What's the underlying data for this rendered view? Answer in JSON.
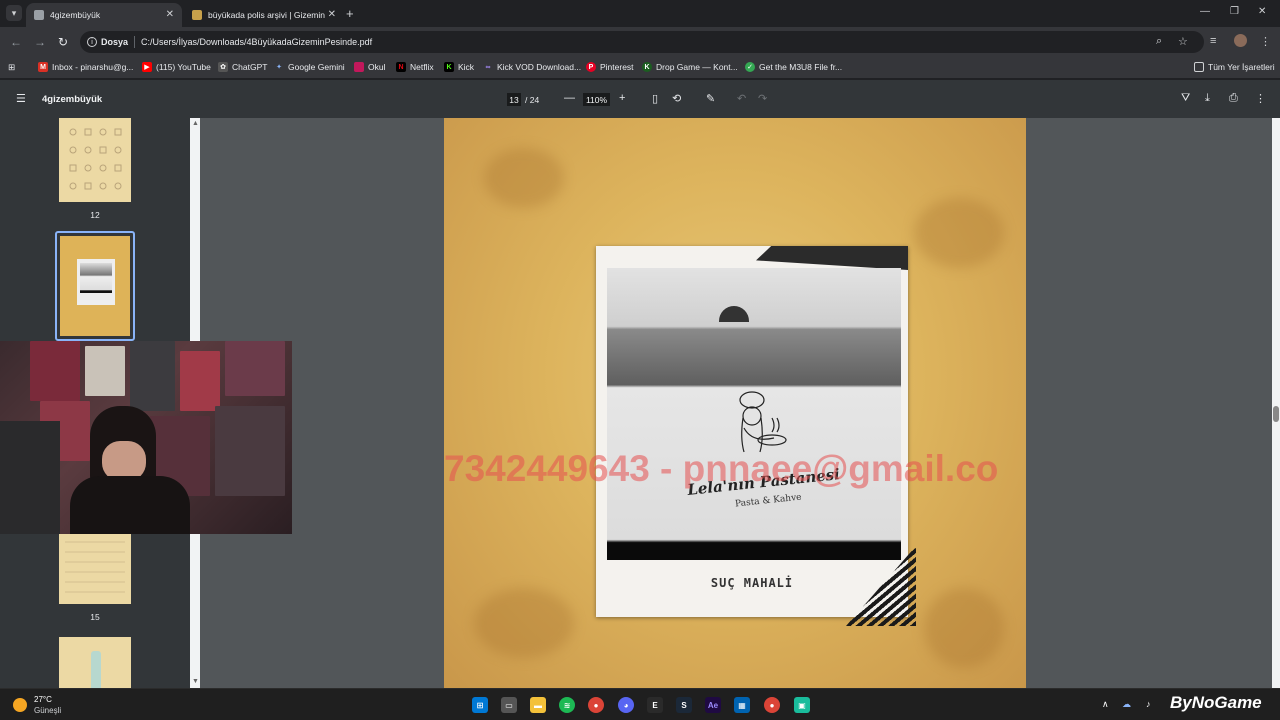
{
  "tabs": [
    {
      "label": "4gizembüyük",
      "active": true
    },
    {
      "label": "büyükada polis arşivi | Gizemin",
      "active": false
    }
  ],
  "address": {
    "chip": "Dosya",
    "url": "C:/Users/İlyas/Downloads/4BüyükadaGizeminPesinde.pdf"
  },
  "bookmarks": [
    {
      "label": "Inbox - pinarshu@g...",
      "icon": "gmail-icon",
      "color": "#d93025"
    },
    {
      "label": "(115) YouTube",
      "icon": "youtube-icon",
      "color": "#ff0000"
    },
    {
      "label": "ChatGPT",
      "icon": "chatgpt-icon",
      "color": "#555555"
    },
    {
      "label": "Google Gemini",
      "icon": "gemini-icon",
      "color": "#4285f4"
    },
    {
      "label": "Okul",
      "icon": "okul-icon",
      "color": "#c2185b"
    },
    {
      "label": "Netflix",
      "icon": "netflix-icon",
      "color": "#e50914"
    },
    {
      "label": "Kick",
      "icon": "kick-icon",
      "color": "#53fc18"
    },
    {
      "label": "Kick VOD Download...",
      "icon": "kickvod-icon",
      "color": "#7b61ff"
    },
    {
      "label": "Pinterest",
      "icon": "pinterest-icon",
      "color": "#e60023"
    },
    {
      "label": "Drop Game — Kont...",
      "icon": "dropgame-icon",
      "color": "#2e7d32"
    },
    {
      "label": "Get the M3U8 File fr...",
      "icon": "m3u8-icon",
      "color": "#34a853"
    }
  ],
  "bookmarks_all": "Tüm Yer İşaretleri",
  "pdf": {
    "title": "4gizembüyük",
    "page_current": "13",
    "page_total": "/ 24",
    "zoom": "110%"
  },
  "thumbnails": [
    {
      "num": "12"
    },
    {
      "num": "15"
    }
  ],
  "page_content": {
    "box_brand": "Lela'nın Pastanesi",
    "box_sub": "Pasta & Kahve",
    "caption": "SUÇ MAHALİ",
    "watermark": "7342449643 - pnnaee@gmail.co"
  },
  "taskbar": {
    "temp": "27°C",
    "weather": "Güneşli",
    "brand": "ByNoGame"
  }
}
